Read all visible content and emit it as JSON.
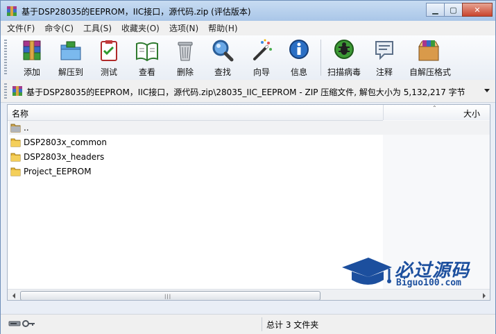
{
  "window": {
    "title": "基于DSP28035的EEPROM，IIC接口，源代码.zip (评估版本)"
  },
  "menu": [
    {
      "label": "文件(F)"
    },
    {
      "label": "命令(C)"
    },
    {
      "label": "工具(S)"
    },
    {
      "label": "收藏夹(O)"
    },
    {
      "label": "选项(N)"
    },
    {
      "label": "帮助(H)"
    }
  ],
  "toolbar": {
    "add": "添加",
    "extract": "解压到",
    "test": "测试",
    "view": "查看",
    "delete": "删除",
    "find": "查找",
    "wizard": "向导",
    "info": "信息",
    "virus_scan": "扫描病毒",
    "comment": "注释",
    "sfx": "自解压格式"
  },
  "address": {
    "path": "基于DSP28035的EEPROM，IIC接口，源代码.zip\\28035_IIC_EEPROM - ZIP 压缩文件, 解包大小为 5,132,217 字节"
  },
  "columns": {
    "name": "名称",
    "size": "大小"
  },
  "files": [
    {
      "name": ".."
    },
    {
      "name": "DSP2803x_common"
    },
    {
      "name": "DSP2803x_headers"
    },
    {
      "name": "Project_EEPROM"
    }
  ],
  "watermark": {
    "main": "必过源码",
    "sub": "Biguo100.com"
  },
  "status": {
    "summary": "总计 3 文件夹"
  },
  "colors": {
    "accent": "#1c4f9e",
    "titlebar": "#b9d1ee",
    "folder": "#e8b93a"
  }
}
